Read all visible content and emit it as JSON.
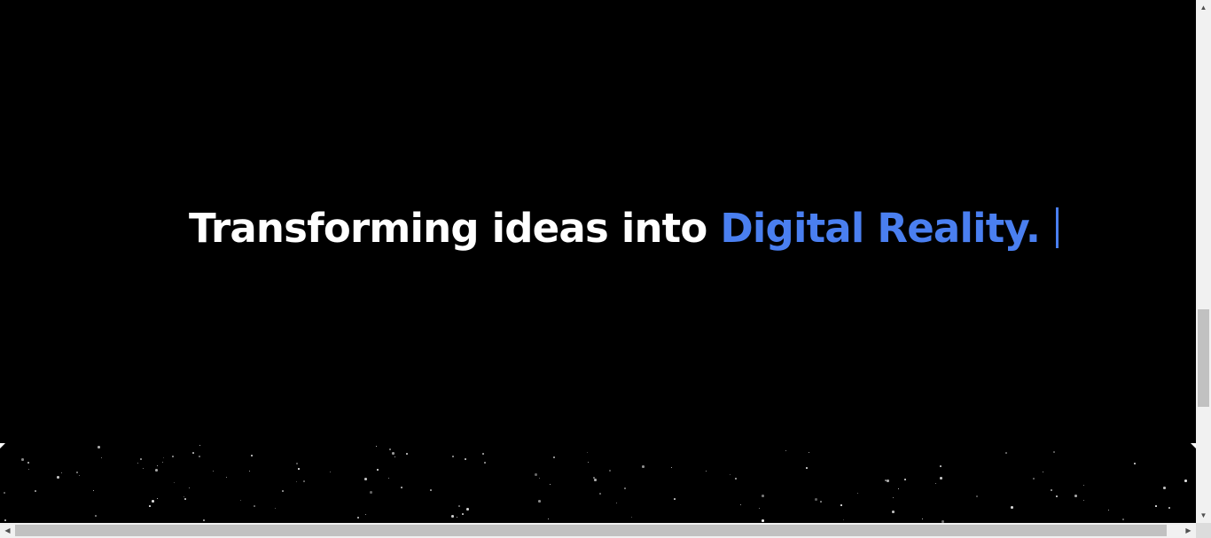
{
  "hero": {
    "headline_main": "Transforming ideas into ",
    "headline_accent": "Digital Reality."
  },
  "colors": {
    "background": "#000000",
    "headline": "#ffffff",
    "accent": "#4a7ff0",
    "scrollbar_track": "#f1f1f1",
    "scrollbar_thumb": "#c1c1c1"
  },
  "scrollbars": {
    "vertical_arrow_up": "▲",
    "vertical_arrow_down": "▼",
    "horizontal_arrow_left": "◀",
    "horizontal_arrow_right": "▶"
  }
}
